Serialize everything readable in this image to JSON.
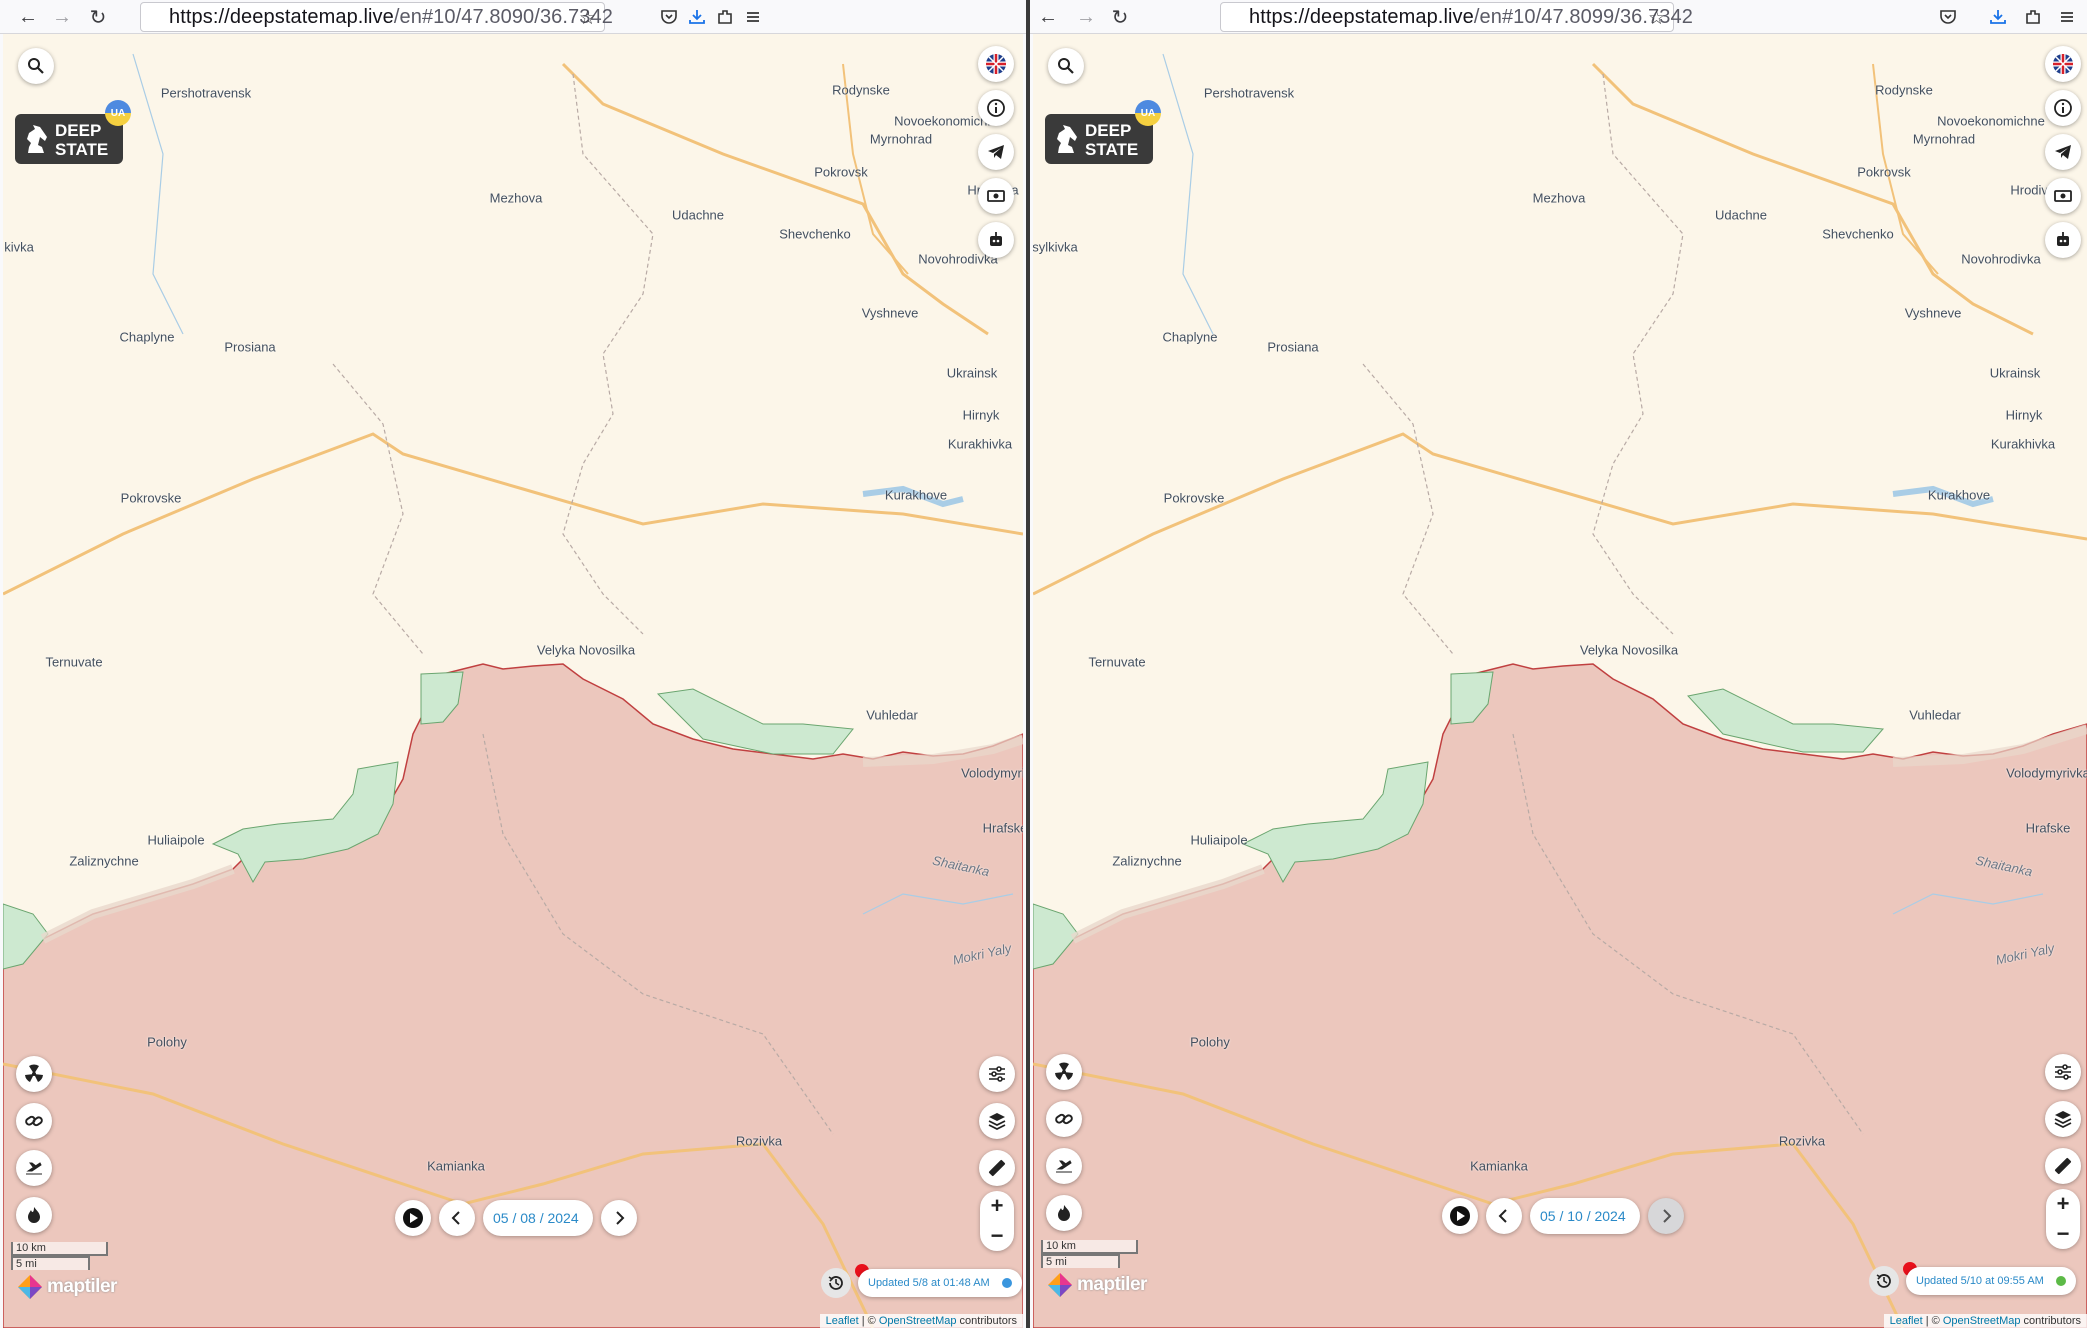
{
  "browser_left": {
    "url_host": "https://deepstatemap.live",
    "url_rest": "/en#10/47.8090/36.7342"
  },
  "browser_right": {
    "url_host": "https://deepstatemap.live",
    "url_rest": "/en#10/47.8099/36.7342"
  },
  "logo": {
    "line1": "DEEP",
    "line2": "STATE",
    "badge": "UA"
  },
  "places": [
    "Pershotravensk",
    "Rodynske",
    "Novoekonomichne",
    "Myrnohrad",
    "Pokrovsk",
    "Mezhova",
    "Udachne",
    "Shevchenko",
    "Hrodivka",
    "Novohrodivka",
    "Chaplyne",
    "Prosiana",
    "Vyshneve",
    "Ukrainsk",
    "Hirnyk",
    "Kurakhivka",
    "Pokrovske",
    "Kurakhove",
    "Ternuvate",
    "Velyka Novosilka",
    "Vuhledar",
    "Volodymyrivka",
    "Huliaipole",
    "Zaliznychne",
    "Hrafske",
    "Shaitanka",
    "Mokri Yaly",
    "Polohy",
    "Rozivka",
    "Kamianka"
  ],
  "left_edge_place": {
    "left": "kivka",
    "right": "sylkivka"
  },
  "left": {
    "date": "05 / 08 / 2024",
    "updated": "Updated 5/8 at 01:48 AM",
    "status_color": "#3a96de"
  },
  "right": {
    "date": "05 / 10 / 2024",
    "updated": "Updated 5/10 at 09:55 AM",
    "status_color": "#5cba47"
  },
  "scale": {
    "km": "10 km",
    "mi": "5 mi"
  },
  "maptiler": "maptiler",
  "attribution": {
    "leaflet": "Leaflet",
    "sep": " | © ",
    "osm": "OpenStreetMap",
    "tail": " contributors"
  },
  "zoom": {
    "in": "+",
    "out": "−"
  },
  "colors": {
    "occupied": "#ecc7bd",
    "liberated": "#cde9d0",
    "front": "#c04040",
    "road": "#f2c27a"
  }
}
